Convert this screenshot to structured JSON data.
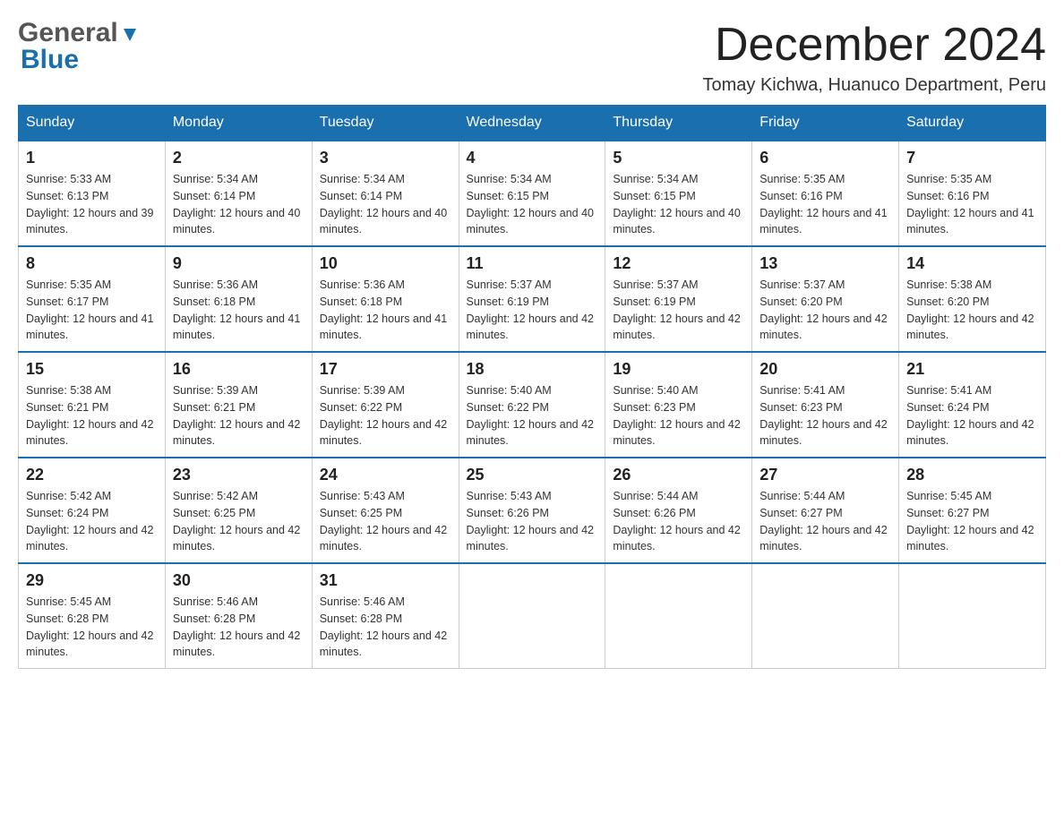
{
  "header": {
    "logo_general": "General",
    "logo_blue": "Blue",
    "month_title": "December 2024",
    "location": "Tomay Kichwa, Huanuco Department, Peru"
  },
  "weekdays": [
    "Sunday",
    "Monday",
    "Tuesday",
    "Wednesday",
    "Thursday",
    "Friday",
    "Saturday"
  ],
  "weeks": [
    [
      {
        "day": "1",
        "sunrise": "Sunrise: 5:33 AM",
        "sunset": "Sunset: 6:13 PM",
        "daylight": "Daylight: 12 hours and 39 minutes."
      },
      {
        "day": "2",
        "sunrise": "Sunrise: 5:34 AM",
        "sunset": "Sunset: 6:14 PM",
        "daylight": "Daylight: 12 hours and 40 minutes."
      },
      {
        "day": "3",
        "sunrise": "Sunrise: 5:34 AM",
        "sunset": "Sunset: 6:14 PM",
        "daylight": "Daylight: 12 hours and 40 minutes."
      },
      {
        "day": "4",
        "sunrise": "Sunrise: 5:34 AM",
        "sunset": "Sunset: 6:15 PM",
        "daylight": "Daylight: 12 hours and 40 minutes."
      },
      {
        "day": "5",
        "sunrise": "Sunrise: 5:34 AM",
        "sunset": "Sunset: 6:15 PM",
        "daylight": "Daylight: 12 hours and 40 minutes."
      },
      {
        "day": "6",
        "sunrise": "Sunrise: 5:35 AM",
        "sunset": "Sunset: 6:16 PM",
        "daylight": "Daylight: 12 hours and 41 minutes."
      },
      {
        "day": "7",
        "sunrise": "Sunrise: 5:35 AM",
        "sunset": "Sunset: 6:16 PM",
        "daylight": "Daylight: 12 hours and 41 minutes."
      }
    ],
    [
      {
        "day": "8",
        "sunrise": "Sunrise: 5:35 AM",
        "sunset": "Sunset: 6:17 PM",
        "daylight": "Daylight: 12 hours and 41 minutes."
      },
      {
        "day": "9",
        "sunrise": "Sunrise: 5:36 AM",
        "sunset": "Sunset: 6:18 PM",
        "daylight": "Daylight: 12 hours and 41 minutes."
      },
      {
        "day": "10",
        "sunrise": "Sunrise: 5:36 AM",
        "sunset": "Sunset: 6:18 PM",
        "daylight": "Daylight: 12 hours and 41 minutes."
      },
      {
        "day": "11",
        "sunrise": "Sunrise: 5:37 AM",
        "sunset": "Sunset: 6:19 PM",
        "daylight": "Daylight: 12 hours and 42 minutes."
      },
      {
        "day": "12",
        "sunrise": "Sunrise: 5:37 AM",
        "sunset": "Sunset: 6:19 PM",
        "daylight": "Daylight: 12 hours and 42 minutes."
      },
      {
        "day": "13",
        "sunrise": "Sunrise: 5:37 AM",
        "sunset": "Sunset: 6:20 PM",
        "daylight": "Daylight: 12 hours and 42 minutes."
      },
      {
        "day": "14",
        "sunrise": "Sunrise: 5:38 AM",
        "sunset": "Sunset: 6:20 PM",
        "daylight": "Daylight: 12 hours and 42 minutes."
      }
    ],
    [
      {
        "day": "15",
        "sunrise": "Sunrise: 5:38 AM",
        "sunset": "Sunset: 6:21 PM",
        "daylight": "Daylight: 12 hours and 42 minutes."
      },
      {
        "day": "16",
        "sunrise": "Sunrise: 5:39 AM",
        "sunset": "Sunset: 6:21 PM",
        "daylight": "Daylight: 12 hours and 42 minutes."
      },
      {
        "day": "17",
        "sunrise": "Sunrise: 5:39 AM",
        "sunset": "Sunset: 6:22 PM",
        "daylight": "Daylight: 12 hours and 42 minutes."
      },
      {
        "day": "18",
        "sunrise": "Sunrise: 5:40 AM",
        "sunset": "Sunset: 6:22 PM",
        "daylight": "Daylight: 12 hours and 42 minutes."
      },
      {
        "day": "19",
        "sunrise": "Sunrise: 5:40 AM",
        "sunset": "Sunset: 6:23 PM",
        "daylight": "Daylight: 12 hours and 42 minutes."
      },
      {
        "day": "20",
        "sunrise": "Sunrise: 5:41 AM",
        "sunset": "Sunset: 6:23 PM",
        "daylight": "Daylight: 12 hours and 42 minutes."
      },
      {
        "day": "21",
        "sunrise": "Sunrise: 5:41 AM",
        "sunset": "Sunset: 6:24 PM",
        "daylight": "Daylight: 12 hours and 42 minutes."
      }
    ],
    [
      {
        "day": "22",
        "sunrise": "Sunrise: 5:42 AM",
        "sunset": "Sunset: 6:24 PM",
        "daylight": "Daylight: 12 hours and 42 minutes."
      },
      {
        "day": "23",
        "sunrise": "Sunrise: 5:42 AM",
        "sunset": "Sunset: 6:25 PM",
        "daylight": "Daylight: 12 hours and 42 minutes."
      },
      {
        "day": "24",
        "sunrise": "Sunrise: 5:43 AM",
        "sunset": "Sunset: 6:25 PM",
        "daylight": "Daylight: 12 hours and 42 minutes."
      },
      {
        "day": "25",
        "sunrise": "Sunrise: 5:43 AM",
        "sunset": "Sunset: 6:26 PM",
        "daylight": "Daylight: 12 hours and 42 minutes."
      },
      {
        "day": "26",
        "sunrise": "Sunrise: 5:44 AM",
        "sunset": "Sunset: 6:26 PM",
        "daylight": "Daylight: 12 hours and 42 minutes."
      },
      {
        "day": "27",
        "sunrise": "Sunrise: 5:44 AM",
        "sunset": "Sunset: 6:27 PM",
        "daylight": "Daylight: 12 hours and 42 minutes."
      },
      {
        "day": "28",
        "sunrise": "Sunrise: 5:45 AM",
        "sunset": "Sunset: 6:27 PM",
        "daylight": "Daylight: 12 hours and 42 minutes."
      }
    ],
    [
      {
        "day": "29",
        "sunrise": "Sunrise: 5:45 AM",
        "sunset": "Sunset: 6:28 PM",
        "daylight": "Daylight: 12 hours and 42 minutes."
      },
      {
        "day": "30",
        "sunrise": "Sunrise: 5:46 AM",
        "sunset": "Sunset: 6:28 PM",
        "daylight": "Daylight: 12 hours and 42 minutes."
      },
      {
        "day": "31",
        "sunrise": "Sunrise: 5:46 AM",
        "sunset": "Sunset: 6:28 PM",
        "daylight": "Daylight: 12 hours and 42 minutes."
      },
      null,
      null,
      null,
      null
    ]
  ]
}
